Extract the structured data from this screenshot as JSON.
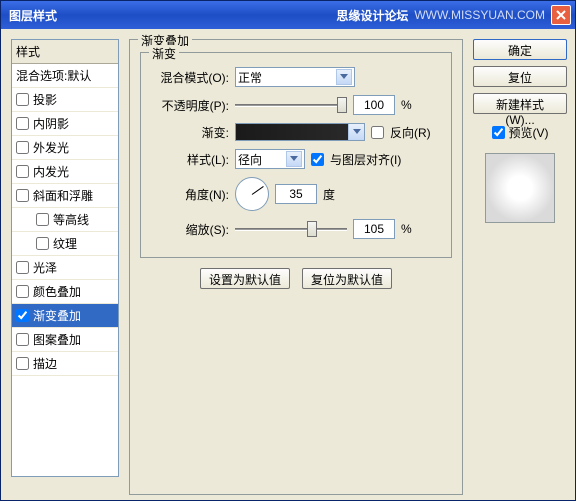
{
  "titlebar": {
    "title": "图层样式",
    "watermark1": "思缘设计论坛",
    "watermark2": "WWW.MISSYUAN.COM"
  },
  "left": {
    "header": "样式",
    "blend_defaults": "混合选项:默认",
    "items": {
      "drop_shadow": "投影",
      "inner_shadow": "内阴影",
      "outer_glow": "外发光",
      "inner_glow": "内发光",
      "bevel": "斜面和浮雕",
      "contour": "等高线",
      "texture": "纹理",
      "satin": "光泽",
      "color_overlay": "颜色叠加",
      "gradient_overlay": "渐变叠加",
      "pattern_overlay": "图案叠加",
      "stroke": "描边"
    }
  },
  "main": {
    "title": "渐变叠加",
    "inner_title": "渐变",
    "blend_mode_label": "混合模式(O):",
    "blend_mode_value": "正常",
    "opacity_label": "不透明度(P):",
    "opacity_value": "100",
    "percent": "%",
    "gradient_label": "渐变:",
    "reverse_label": "反向(R)",
    "style_label": "样式(L):",
    "style_value": "径向",
    "align_label": "与图层对齐(I)",
    "angle_label": "角度(N):",
    "angle_value": "35",
    "degree": "度",
    "scale_label": "缩放(S):",
    "scale_value": "105",
    "btn_default": "设置为默认值",
    "btn_reset": "复位为默认值"
  },
  "right": {
    "ok": "确定",
    "cancel": "复位",
    "new_style": "新建样式(W)...",
    "preview": "预览(V)"
  }
}
